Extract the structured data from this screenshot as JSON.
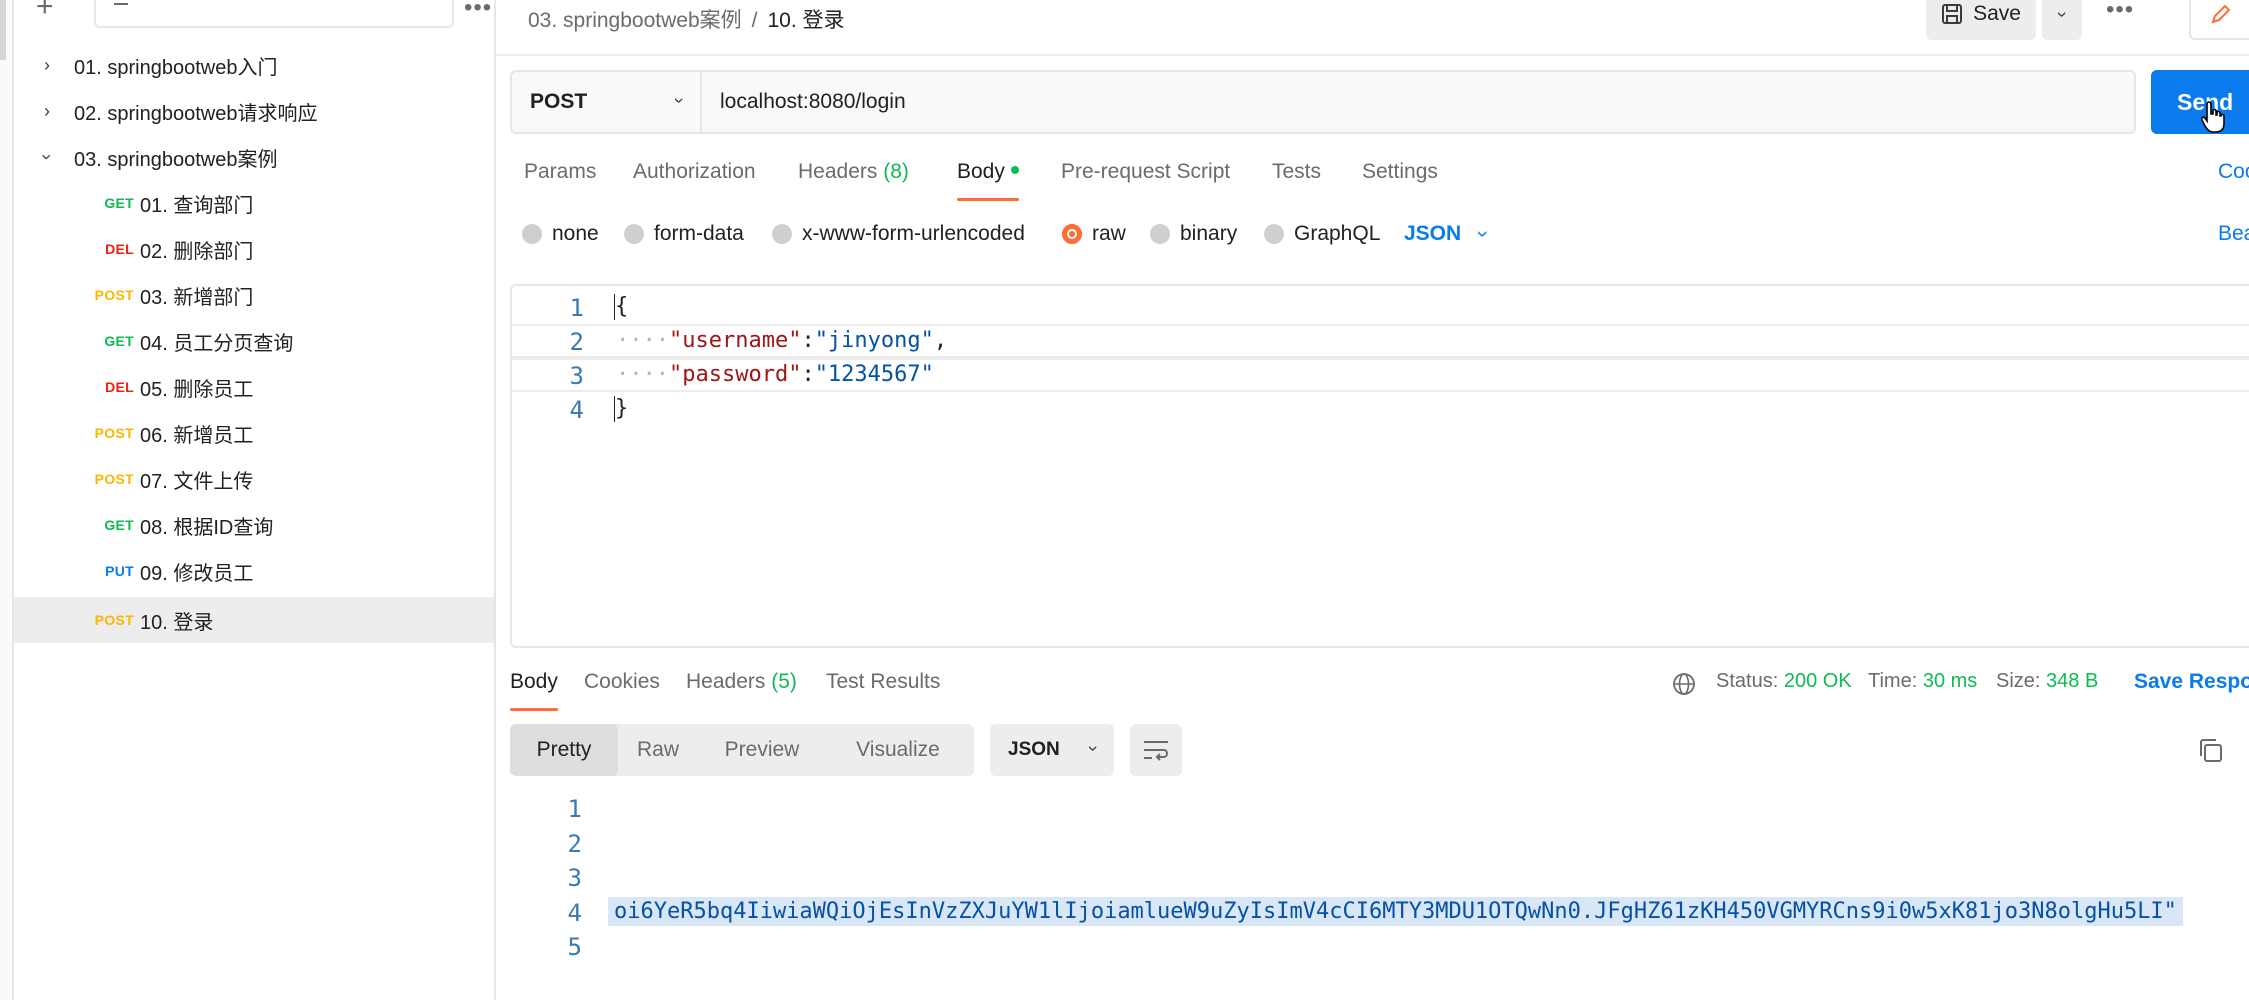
{
  "sidebar": {
    "folders": [
      {
        "label": "01. springbootweb入门",
        "expanded": false
      },
      {
        "label": "02. springbootweb请求响应",
        "expanded": false
      },
      {
        "label": "03. springbootweb案例",
        "expanded": true
      }
    ],
    "requests": [
      {
        "method": "GET",
        "label": "01. 查询部门"
      },
      {
        "method": "DEL",
        "label": "02. 删除部门"
      },
      {
        "method": "POST",
        "label": "03. 新增部门"
      },
      {
        "method": "GET",
        "label": "04. 员工分页查询"
      },
      {
        "method": "DEL",
        "label": "05. 删除员工"
      },
      {
        "method": "POST",
        "label": "06. 新增员工"
      },
      {
        "method": "POST",
        "label": "07. 文件上传"
      },
      {
        "method": "GET",
        "label": "08. 根据ID查询"
      },
      {
        "method": "PUT",
        "label": "09. 修改员工"
      },
      {
        "method": "POST",
        "label": "10. 登录"
      }
    ],
    "selected_index": 9
  },
  "header": {
    "breadcrumb_parent": "03. springbootweb案例",
    "breadcrumb_separator": "/",
    "breadcrumb_current": "10. 登录",
    "save_label": "Save"
  },
  "request": {
    "method": "POST",
    "url": "localhost:8080/login",
    "send_label": "Send",
    "tabs": {
      "params": "Params",
      "authorization": "Authorization",
      "headers": "Headers",
      "headers_count": "(8)",
      "body": "Body",
      "prerequest": "Pre-request Script",
      "tests": "Tests",
      "settings": "Settings",
      "cookies_partial": "Coo"
    },
    "body_types": {
      "none": "none",
      "form_data": "form-data",
      "urlencoded": "x-www-form-urlencoded",
      "raw": "raw",
      "binary": "binary",
      "graphql": "GraphQL",
      "json": "JSON",
      "beautify_partial": "Bea"
    },
    "code_lines": [
      {
        "num": "1",
        "open": "{"
      },
      {
        "num": "2",
        "indent": "····",
        "key": "\"username\"",
        "colon": ":",
        "value": "\"jinyong\"",
        "tail": ","
      },
      {
        "num": "3",
        "indent": "····",
        "key": "\"password\"",
        "colon": ":",
        "value": "\"1234567\"",
        "tail": ""
      },
      {
        "num": "4",
        "close": "}"
      }
    ]
  },
  "response": {
    "tabs": {
      "body": "Body",
      "cookies": "Cookies",
      "headers": "Headers",
      "headers_count": "(5)",
      "test_results": "Test Results"
    },
    "status_label": "Status:",
    "status_value": "200 OK",
    "time_label": "Time:",
    "time_value": "30 ms",
    "size_label": "Size:",
    "size_value": "348 B",
    "save_partial": "Save Respo",
    "views": {
      "pretty": "Pretty",
      "raw": "Raw",
      "preview": "Preview",
      "visualize": "Visualize"
    },
    "format": "JSON",
    "line_numbers": [
      "1",
      "2",
      "3",
      "4",
      "5"
    ],
    "line4_text": "oi6YeR5bq4IiwiaWQiOjEsInVzZXJuYW1lIjoiamlueW9uZyIsImV4cCI6MTY3MDU1OTQwNn0.JFgHZ61zKH450VGMYRCns9i0w5xK81jo3N8olgHu5LI\""
  },
  "colors": {
    "accent_orange": "#ff6c37",
    "send_blue": "#097bed",
    "status_green": "#0cbb52"
  }
}
